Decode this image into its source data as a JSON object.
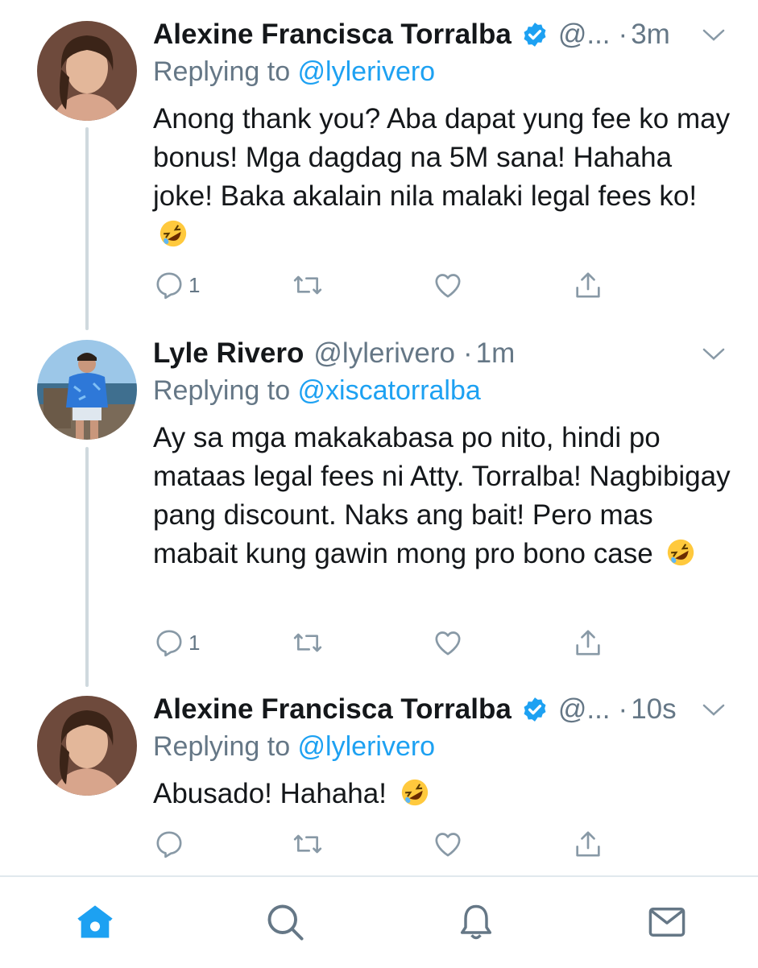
{
  "tweets": [
    {
      "name": "Alexine Francisca Torralba",
      "handle": "@...",
      "dot": "·",
      "time": "3m",
      "reply_prefix": "Replying to ",
      "reply_to": "@lylerivero",
      "text": "Anong thank you? Aba dapat yung fee ko may bonus! Mga dagdag na 5M sana! Hahaha joke! Baka akalain nila malaki legal fees ko!",
      "reply_count": "1"
    },
    {
      "name": "Lyle Rivero",
      "handle": "@lylerivero",
      "dot": "·",
      "time": "1m",
      "reply_prefix": "Replying to ",
      "reply_to": "@xiscatorralba",
      "text": "Ay sa mga makakabasa po nito, hindi po mataas legal fees ni Atty. Torralba! Nagbibigay pang discount. Naks ang bait! Pero mas mabait kung gawin mong pro bono case",
      "reply_count": "1"
    },
    {
      "name": "Alexine Francisca Torralba",
      "handle": "@...",
      "dot": "·",
      "time": "10s",
      "reply_prefix": "Replying to ",
      "reply_to": "@lylerivero",
      "text": "Abusado! Hahaha!",
      "reply_count": ""
    }
  ],
  "emoji": "rolling-on-floor-laughing-emoji",
  "icons": {
    "reply": "reply-icon",
    "retweet": "retweet-icon",
    "like": "heart-icon",
    "share": "share-icon",
    "more": "chevron-down-icon",
    "verified": "verified-badge-icon"
  },
  "tabbar": [
    "home-icon",
    "search-icon",
    "notifications-icon",
    "messages-icon"
  ],
  "colors": {
    "accent": "#1da1f2",
    "secondary_text": "#657786",
    "thread_line": "#cfd9de"
  }
}
